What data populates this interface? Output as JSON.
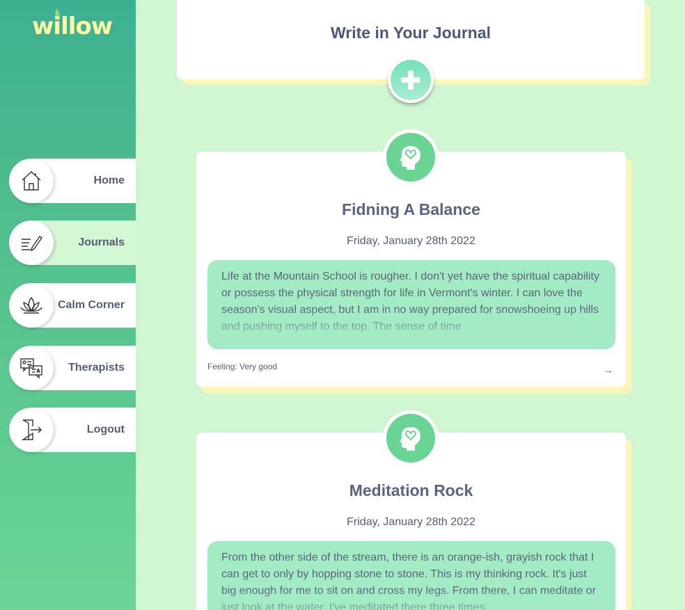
{
  "app": {
    "logo_text": "willow"
  },
  "sidebar": {
    "items": [
      {
        "label": "Home",
        "icon": "home-icon",
        "active": false
      },
      {
        "label": "Journals",
        "icon": "pencil-note-icon",
        "active": true
      },
      {
        "label": "Calm Corner",
        "icon": "lotus-icon",
        "active": false
      },
      {
        "label": "Therapists",
        "icon": "chat-bubbles-icon",
        "active": false
      },
      {
        "label": "Logout",
        "icon": "logout-door-icon",
        "active": false
      }
    ]
  },
  "write": {
    "title": "Write in Your Journal",
    "add_icon": "plus-icon"
  },
  "entries": [
    {
      "title": "Fidning A Balance",
      "date": "Friday, January 28th 2022",
      "text": "Life at the Mountain School is rougher. I don't yet have the spiritual capability or possess the physical strength for life in Vermont's winter. I can love the season's visual aspect, but I am in no way prepared for snowshoeing up hills and pushing myself to the top. The sense of time",
      "feeling": "Feeling: Very good",
      "arrow": "→",
      "icon": "mind-heart-icon"
    },
    {
      "title": "Meditation Rock",
      "date": "Friday, January 28th 2022",
      "text": "From the other side of the stream, there is an orange-ish, grayish rock that I can get to only by hopping stone to stone. This is my thinking rock. It's just big enough for me to sit on and cross my legs. From there, I can meditate or just look at the water. I've meditated there three times.",
      "icon": "mind-heart-icon"
    }
  ],
  "colors": {
    "background": "#cff5d1",
    "sidebar_top": "#3db091",
    "sidebar_bottom": "#6bd595",
    "accent_green": "#69d494",
    "card_body": "#a2ebc4",
    "card_shadow": "#fbf6b7",
    "logo": "#fdf5a6"
  }
}
